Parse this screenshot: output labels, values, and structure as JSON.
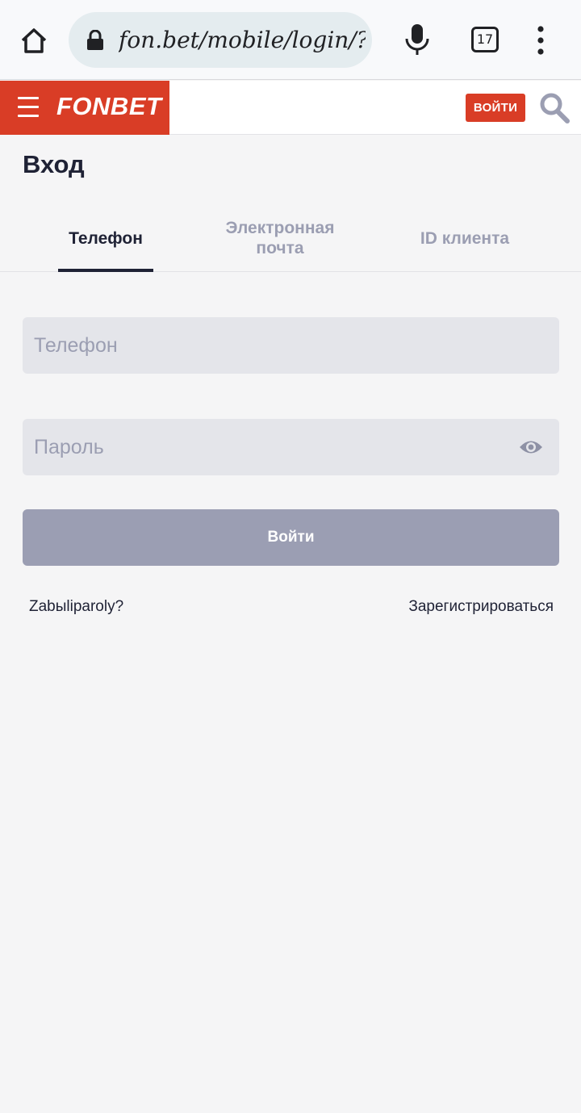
{
  "browser": {
    "url": "fon.bet/mobile/login/?!",
    "tab_count": "17"
  },
  "header": {
    "logo_text": "FONBET",
    "login_button": "ВОЙТИ",
    "brand_color": "#d93d26"
  },
  "page": {
    "title": "Вход"
  },
  "tabs": [
    {
      "label": "Телефон",
      "active": true
    },
    {
      "label": "Электронная почта",
      "active": false
    },
    {
      "label": "ID клиента",
      "active": false
    }
  ],
  "form": {
    "phone_placeholder": "Телефон",
    "password_placeholder": "Пароль",
    "submit_label": "Войти"
  },
  "links": {
    "forgot_password": "Zabыliparoly?",
    "register": "Зарегистрироваться"
  },
  "icons": [
    "home-icon",
    "lock-icon",
    "mic-icon",
    "tabs-icon",
    "more-vert-icon",
    "hamburger-icon",
    "search-icon",
    "eye-icon"
  ]
}
